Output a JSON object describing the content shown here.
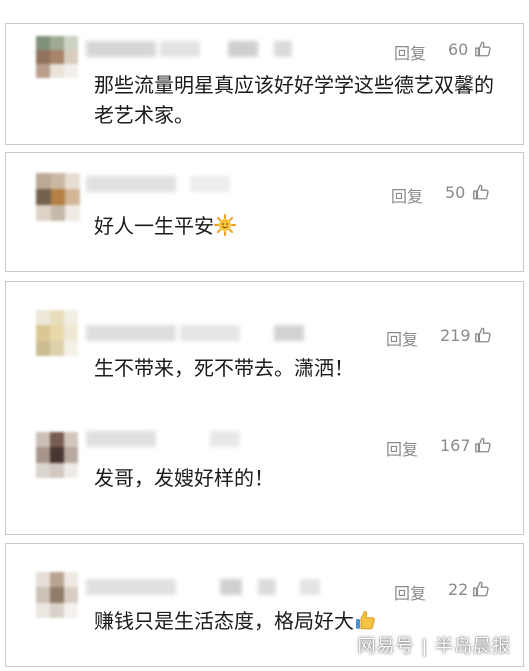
{
  "reply_label": "回复",
  "cards": [
    {
      "comments": [
        {
          "likes": "60",
          "text": "那些流量明星真应该好好学学这些德艺双馨的老艺术家。"
        }
      ]
    },
    {
      "comments": [
        {
          "likes": "50",
          "text": "好人一生平安",
          "emoji": "sun-emoji"
        }
      ]
    },
    {
      "comments": [
        {
          "likes": "219",
          "text": "生不带来，死不带去。潇洒！"
        },
        {
          "likes": "167",
          "text": "发哥，发嫂好样的！"
        }
      ]
    },
    {
      "comments": [
        {
          "likes": "22",
          "text": "赚钱只是生活态度，格局好大",
          "emoji": "thumbs-up-emoji"
        }
      ]
    }
  ],
  "watermark": "网易号 | 半岛晨报",
  "colors": {
    "border": "#c9c9c9",
    "meta_text": "#8a8a8a",
    "body_text": "#1a1a1a"
  }
}
